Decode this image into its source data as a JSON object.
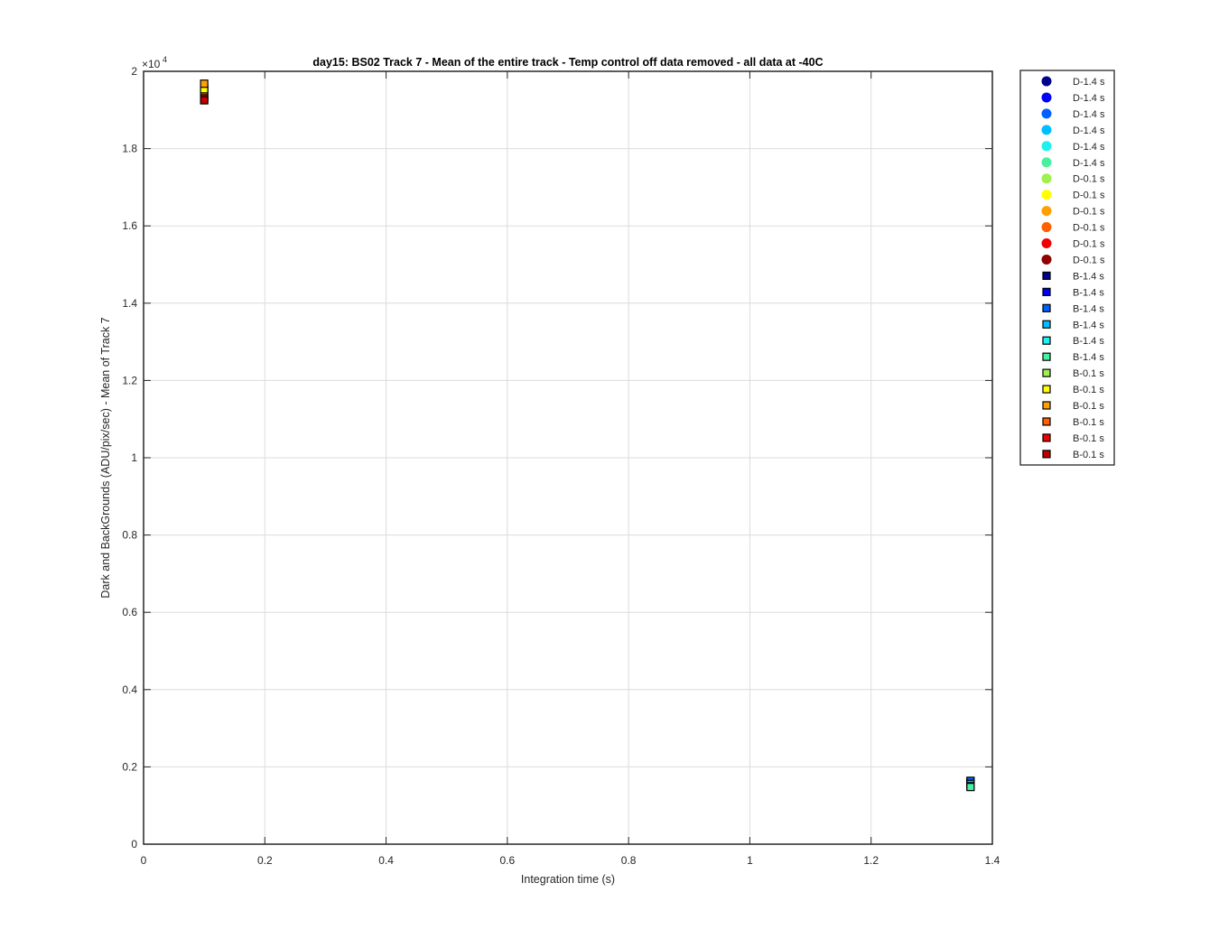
{
  "chart_data": {
    "type": "scatter",
    "title": "day15: BS02  Track 7 - Mean of the entire track - Temp control off data removed - all data at -40C",
    "xlabel": "Integration time (s)",
    "ylabel": "Dark and BackGrounds (ADU/pix/sec) - Mean of Track 7",
    "xlim": [
      0,
      1.4
    ],
    "ylim": [
      0,
      20000
    ],
    "x_ticks": [
      "0",
      "0.2",
      "0.4",
      "0.6",
      "0.8",
      "1",
      "1.2",
      "1.4"
    ],
    "y_ticks": [
      "0",
      "0.2",
      "0.4",
      "0.6",
      "0.8",
      "1",
      "1.2",
      "1.4",
      "1.6",
      "1.8",
      "2"
    ],
    "y_exponent_base": "×10",
    "y_exponent_power": "4",
    "grid": true,
    "legend_position": "outside-right",
    "series": [
      {
        "name": "D-1.4 s",
        "marker": "circle",
        "color": "#00008F",
        "x": [],
        "y": []
      },
      {
        "name": "D-1.4 s",
        "marker": "circle",
        "color": "#0000FF",
        "x": [],
        "y": []
      },
      {
        "name": "D-1.4 s",
        "marker": "circle",
        "color": "#0060FF",
        "x": [],
        "y": []
      },
      {
        "name": "D-1.4 s",
        "marker": "circle",
        "color": "#00BFFF",
        "x": [],
        "y": []
      },
      {
        "name": "D-1.4 s",
        "marker": "circle",
        "color": "#20F0F0",
        "x": [],
        "y": []
      },
      {
        "name": "D-1.4 s",
        "marker": "circle",
        "color": "#4AF0A0",
        "x": [],
        "y": []
      },
      {
        "name": "D-0.1 s",
        "marker": "circle",
        "color": "#9FF050",
        "x": [],
        "y": []
      },
      {
        "name": "D-0.1 s",
        "marker": "circle",
        "color": "#FFFF00",
        "x": [],
        "y": []
      },
      {
        "name": "D-0.1 s",
        "marker": "circle",
        "color": "#FFA000",
        "x": [],
        "y": []
      },
      {
        "name": "D-0.1 s",
        "marker": "circle",
        "color": "#FF6000",
        "x": [],
        "y": []
      },
      {
        "name": "D-0.1 s",
        "marker": "circle",
        "color": "#F00000",
        "x": [],
        "y": []
      },
      {
        "name": "D-0.1 s",
        "marker": "circle",
        "color": "#900000",
        "x": [],
        "y": []
      },
      {
        "name": "B-1.4 s",
        "marker": "square",
        "color": "#00008F",
        "x": [
          1.364
        ],
        "y": [
          1600
        ]
      },
      {
        "name": "B-1.4 s",
        "marker": "square",
        "color": "#0000FF",
        "x": [
          1.364
        ],
        "y": [
          1620
        ]
      },
      {
        "name": "B-1.4 s",
        "marker": "square",
        "color": "#0060FF",
        "x": [
          1.364
        ],
        "y": [
          1640
        ]
      },
      {
        "name": "B-1.4 s",
        "marker": "square",
        "color": "#00BFFF",
        "x": [
          1.364
        ],
        "y": [
          1560
        ]
      },
      {
        "name": "B-1.4 s",
        "marker": "square",
        "color": "#20F0F0",
        "x": [
          1.364
        ],
        "y": [
          1500
        ]
      },
      {
        "name": "B-1.4 s",
        "marker": "square",
        "color": "#4AF0A0",
        "x": [
          1.364
        ],
        "y": [
          1480
        ]
      },
      {
        "name": "B-0.1 s",
        "marker": "square",
        "color": "#9FF050",
        "x": [
          0.1
        ],
        "y": [
          19550
        ]
      },
      {
        "name": "B-0.1 s",
        "marker": "square",
        "color": "#FFFF00",
        "x": [
          0.1
        ],
        "y": [
          19500
        ]
      },
      {
        "name": "B-0.1 s",
        "marker": "square",
        "color": "#FFA000",
        "x": [
          0.1
        ],
        "y": [
          19680
        ]
      },
      {
        "name": "B-0.1 s",
        "marker": "square",
        "color": "#FF6000",
        "x": [
          0.1
        ],
        "y": [
          19350
        ]
      },
      {
        "name": "B-0.1 s",
        "marker": "square",
        "color": "#F00000",
        "x": [
          0.1
        ],
        "y": [
          19300
        ]
      },
      {
        "name": "B-0.1 s",
        "marker": "square",
        "color": "#C00000",
        "x": [
          0.1
        ],
        "y": [
          19250
        ]
      }
    ]
  }
}
